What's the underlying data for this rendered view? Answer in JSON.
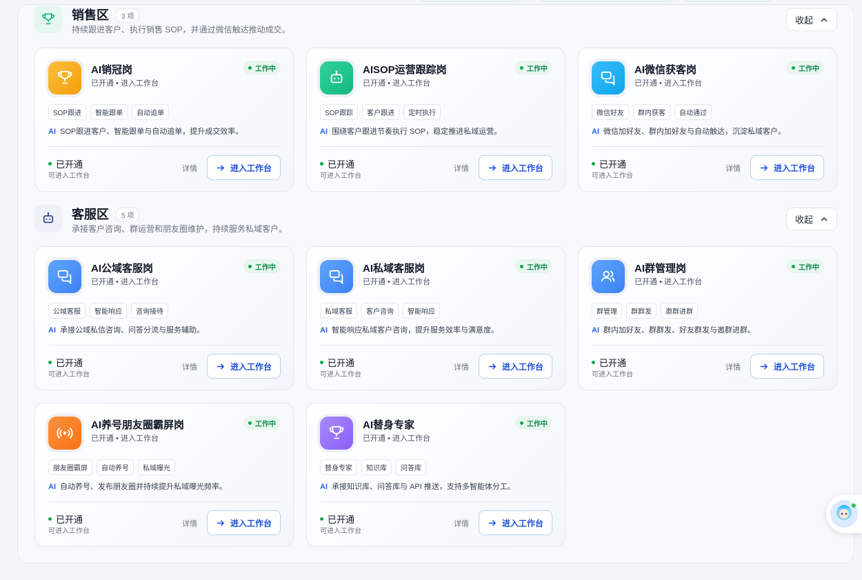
{
  "colors": {
    "accent_blue": "#1d4ed8",
    "status_green": "#0f8a4f",
    "ai_blue": "#2563eb"
  },
  "sections": [
    {
      "title": "销售区",
      "count": "3 项",
      "desc": "持续跟进客户、执行销售 SOP，并通过微信触达推动成交。",
      "collapse_label": "收起",
      "icon": "trophy-icon",
      "cards": [
        {
          "title": "AI销冠岗",
          "sub": "已开通 • 进入工作台",
          "status": "工作中",
          "tags": [
            "SOP跟进",
            "智能跟单",
            "自动追单"
          ],
          "ai": "AI",
          "desc": "SOP跟进客户、智能跟单与自动追单，提升成交效率。",
          "open": "已开通",
          "hint": "可进入工作台",
          "detail": "详情",
          "enter": "进入工作台",
          "icon": "trophy-icon",
          "color": "orange"
        },
        {
          "title": "AISOP运营跟踪岗",
          "sub": "已开通 • 进入工作台",
          "status": "工作中",
          "tags": [
            "SOP跟踪",
            "客户跟进",
            "定时执行"
          ],
          "ai": "AI",
          "desc": "围绕客户跟进节奏执行 SOP，稳定推进私域运营。",
          "open": "已开通",
          "hint": "可进入工作台",
          "detail": "详情",
          "enter": "进入工作台",
          "icon": "robot-icon",
          "color": "green"
        },
        {
          "title": "AI微信获客岗",
          "sub": "已开通 • 进入工作台",
          "status": "工作中",
          "tags": [
            "微信好友",
            "群内获客",
            "自动通过"
          ],
          "ai": "AI",
          "desc": "微信加好友、群内加好友与自动触达，沉淀私域客户。",
          "open": "已开通",
          "hint": "可进入工作台",
          "detail": "详情",
          "enter": "进入工作台",
          "icon": "chat-icon",
          "color": "teal"
        }
      ]
    },
    {
      "title": "客服区",
      "count": "5 项",
      "desc": "承接客户咨询、群运营和朋友圈维护，持续服务私域客户。",
      "collapse_label": "收起",
      "icon": "robot-icon",
      "cards": [
        {
          "title": "AI公域客服岗",
          "sub": "已开通 • 进入工作台",
          "status": "工作中",
          "tags": [
            "公域客服",
            "智能响应",
            "咨询接待"
          ],
          "ai": "AI",
          "desc": "承接公域私信咨询、问答分流与服务辅助。",
          "open": "已开通",
          "hint": "可进入工作台",
          "detail": "详情",
          "enter": "进入工作台",
          "icon": "chat-icon",
          "color": "blue"
        },
        {
          "title": "AI私域客服岗",
          "sub": "已开通 • 进入工作台",
          "status": "工作中",
          "tags": [
            "私域客服",
            "客户咨询",
            "智能响应"
          ],
          "ai": "AI",
          "desc": "智能响应私域客户咨询，提升服务效率与满意度。",
          "open": "已开通",
          "hint": "可进入工作台",
          "detail": "详情",
          "enter": "进入工作台",
          "icon": "chat-icon",
          "color": "blue"
        },
        {
          "title": "AI群管理岗",
          "sub": "已开通 • 进入工作台",
          "status": "工作中",
          "tags": [
            "群管理",
            "群群发",
            "邀群进群"
          ],
          "ai": "AI",
          "desc": "群内加好友、群群发、好友群发与邀群进群。",
          "open": "已开通",
          "hint": "可进入工作台",
          "detail": "详情",
          "enter": "进入工作台",
          "icon": "users-icon",
          "color": "blue"
        },
        {
          "title": "AI养号朋友圈霸屏岗",
          "sub": "已开通 • 进入工作台",
          "status": "工作中",
          "tags": [
            "朋友圈霸屏",
            "自动养号",
            "私域曝光"
          ],
          "ai": "AI",
          "desc": "自动养号、发布朋友圈并持续提升私域曝光频率。",
          "open": "已开通",
          "hint": "可进入工作台",
          "detail": "详情",
          "enter": "进入工作台",
          "icon": "broadcast-icon",
          "color": "deeporange"
        },
        {
          "title": "AI替身专家",
          "sub": "已开通 • 进入工作台",
          "status": "工作中",
          "tags": [
            "替身专家",
            "知识库",
            "问答库"
          ],
          "ai": "AI",
          "desc": "承接知识库、问答库与 API 推送，支持多智能体分工。",
          "open": "已开通",
          "hint": "可进入工作台",
          "detail": "详情",
          "enter": "进入工作台",
          "icon": "trophy-icon",
          "color": "purple"
        }
      ]
    }
  ]
}
